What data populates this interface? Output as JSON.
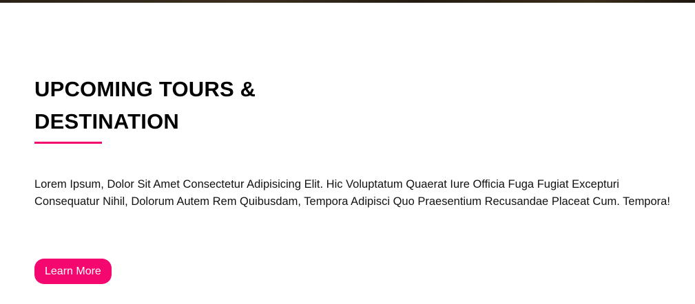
{
  "section": {
    "title": "UPCOMING TOURS & DESTINATION",
    "description": "Lorem Ipsum, Dolor Sit Amet Consectetur Adipisicing Elit. Hic Voluptatum Quaerat Iure Officia Fuga Fugiat Excepturi Consequatur Nihil, Dolorum Autem Rem Quibusdam, Tempora Adipisci Quo Praesentium Recusandae Placeat Cum. Tempora!",
    "cta_label": "Learn More"
  },
  "colors": {
    "accent": "#f4076f",
    "heading": "#000000",
    "text": "#111111",
    "background": "#ffffff"
  }
}
